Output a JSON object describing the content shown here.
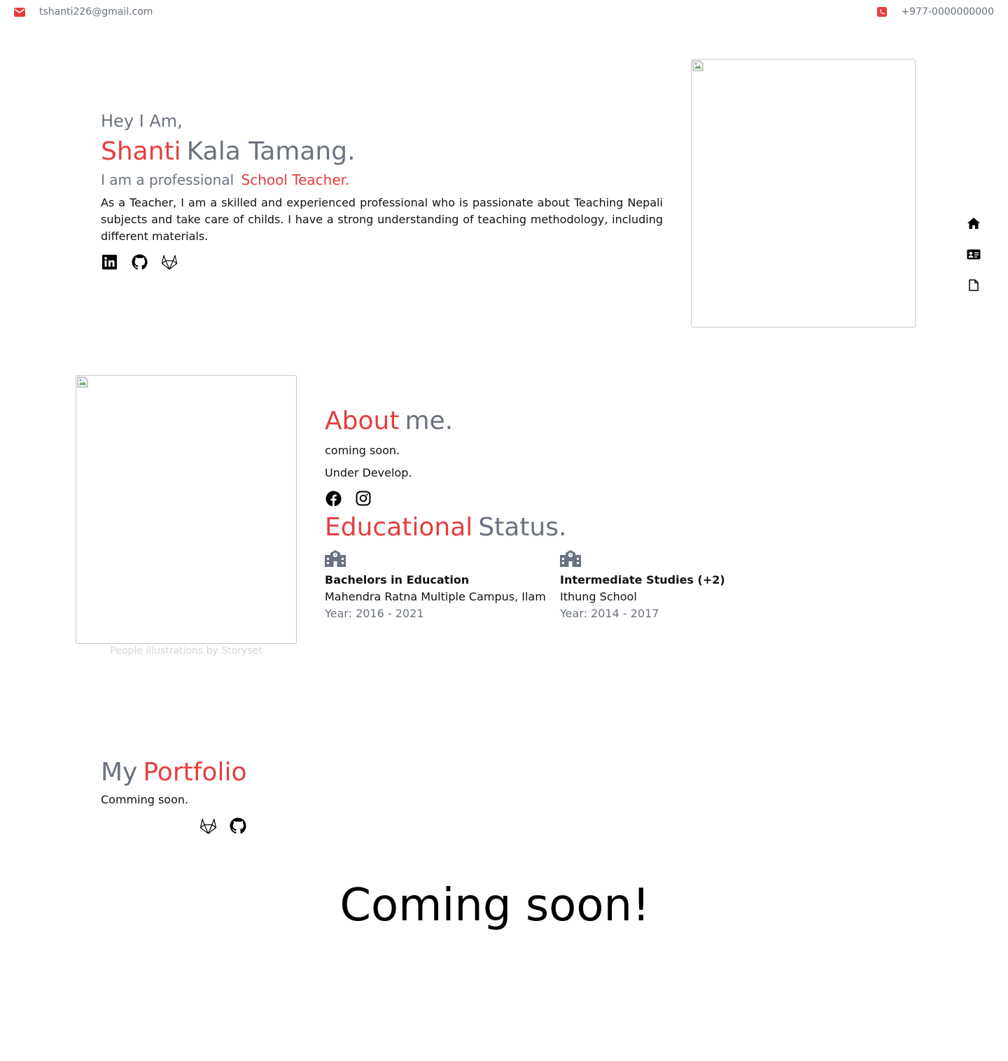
{
  "topbar": {
    "email": "tshanti226@gmail.com",
    "phone": "+977-0000000000",
    "email_icon": "envelope-icon",
    "phone_icon": "phone-icon"
  },
  "hero": {
    "greeting": "Hey I Am,",
    "first_name": "Shanti",
    "last_name": "Kala Tamang.",
    "role_prefix": "I am a professional",
    "role": "School Teacher.",
    "description": "As a Teacher, I am a skilled and experienced professional who is passionate about Teaching Nepali subjects and take care of childs. I have a strong understanding of teaching methodology, including different materials.",
    "socials": [
      "linkedin-icon",
      "github-icon",
      "gitlab-icon"
    ]
  },
  "sidenav": {
    "items": [
      "home-icon",
      "id-card-icon",
      "file-icon"
    ]
  },
  "about": {
    "title_accent": "About",
    "title_rest": "me.",
    "line1": "coming soon.",
    "line2": "Under Develop.",
    "socials": [
      "facebook-icon",
      "instagram-icon"
    ],
    "image_credit": "People illustrations by Storyset"
  },
  "education": {
    "title_accent": "Educational",
    "title_rest": "Status.",
    "items": [
      {
        "degree": "Bachelors in Education",
        "institution": "Mahendra Ratna Multiple Campus, Ilam",
        "year": "Year: 2016 - 2021"
      },
      {
        "degree": "Intermediate Studies (+2)",
        "institution": "Ithung School",
        "year": "Year: 2014 - 2017"
      }
    ]
  },
  "portfolio": {
    "title_prefix": "My",
    "title_accent": "Portfolio",
    "text": "Comming soon.",
    "links": [
      "gitlab-icon",
      "github-icon"
    ]
  },
  "coming_soon": "Coming soon!",
  "colors": {
    "accent": "#e53e3e",
    "muted": "#6b7280",
    "text": "#111111"
  }
}
